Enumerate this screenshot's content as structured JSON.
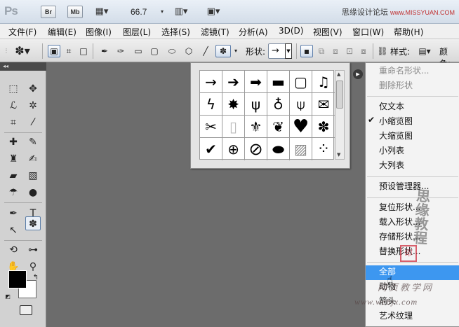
{
  "titlebar": {
    "logo": "Ps",
    "bridge": "Br",
    "minibridge": "Mb",
    "zoom": "66.7",
    "watermark_text": "思缘设计论坛",
    "watermark_url": "www.MISSYUAN.COM"
  },
  "menubar": [
    "文件(F)",
    "编辑(E)",
    "图像(I)",
    "图层(L)",
    "选择(S)",
    "滤镜(T)",
    "分析(A)",
    "3D(D)",
    "视图(V)",
    "窗口(W)",
    "帮助(H)"
  ],
  "options": {
    "shape_label": "形状:",
    "style_label": "样式:",
    "color_label": "颜色:"
  },
  "toolbox": {
    "collapse": "◂◂"
  },
  "shapes_panel": {
    "cells": [
      "→",
      "➔",
      "➡",
      "▬",
      "▢",
      "♫",
      "ϟ",
      "✸",
      "ψ",
      "♁",
      "⍦",
      "✉",
      "✂",
      "▯",
      "⚜",
      "❦",
      "♥",
      "✽",
      "✔",
      "⊕",
      "⊘",
      "⬬",
      "▨",
      "⁘"
    ]
  },
  "context_menu": {
    "items": [
      {
        "label": "重命名形状...",
        "state": "disabled"
      },
      {
        "label": "删除形状",
        "state": "disabled"
      },
      {
        "label": "仅文本",
        "state": "normal"
      },
      {
        "label": "小缩览图",
        "state": "checked"
      },
      {
        "label": "大缩览图",
        "state": "normal"
      },
      {
        "label": "小列表",
        "state": "normal"
      },
      {
        "label": "大列表",
        "state": "normal"
      },
      {
        "label": "预设管理器...",
        "state": "normal"
      },
      {
        "label": "复位形状...",
        "state": "normal"
      },
      {
        "label": "载入形状...",
        "state": "normal"
      },
      {
        "label": "存储形状...",
        "state": "normal"
      },
      {
        "label": "替换形状...",
        "state": "normal"
      },
      {
        "label": "全部",
        "state": "highlighted"
      },
      {
        "label": "动物",
        "state": "normal"
      },
      {
        "label": "箭头",
        "state": "normal"
      },
      {
        "label": "艺术纹理",
        "state": "normal"
      }
    ],
    "check_mark": "✔"
  },
  "watermark": {
    "stamp_text": "思缘教程",
    "seal_text": "印",
    "site_cn": "网页教学网",
    "site_url": "www.webjx.com"
  }
}
